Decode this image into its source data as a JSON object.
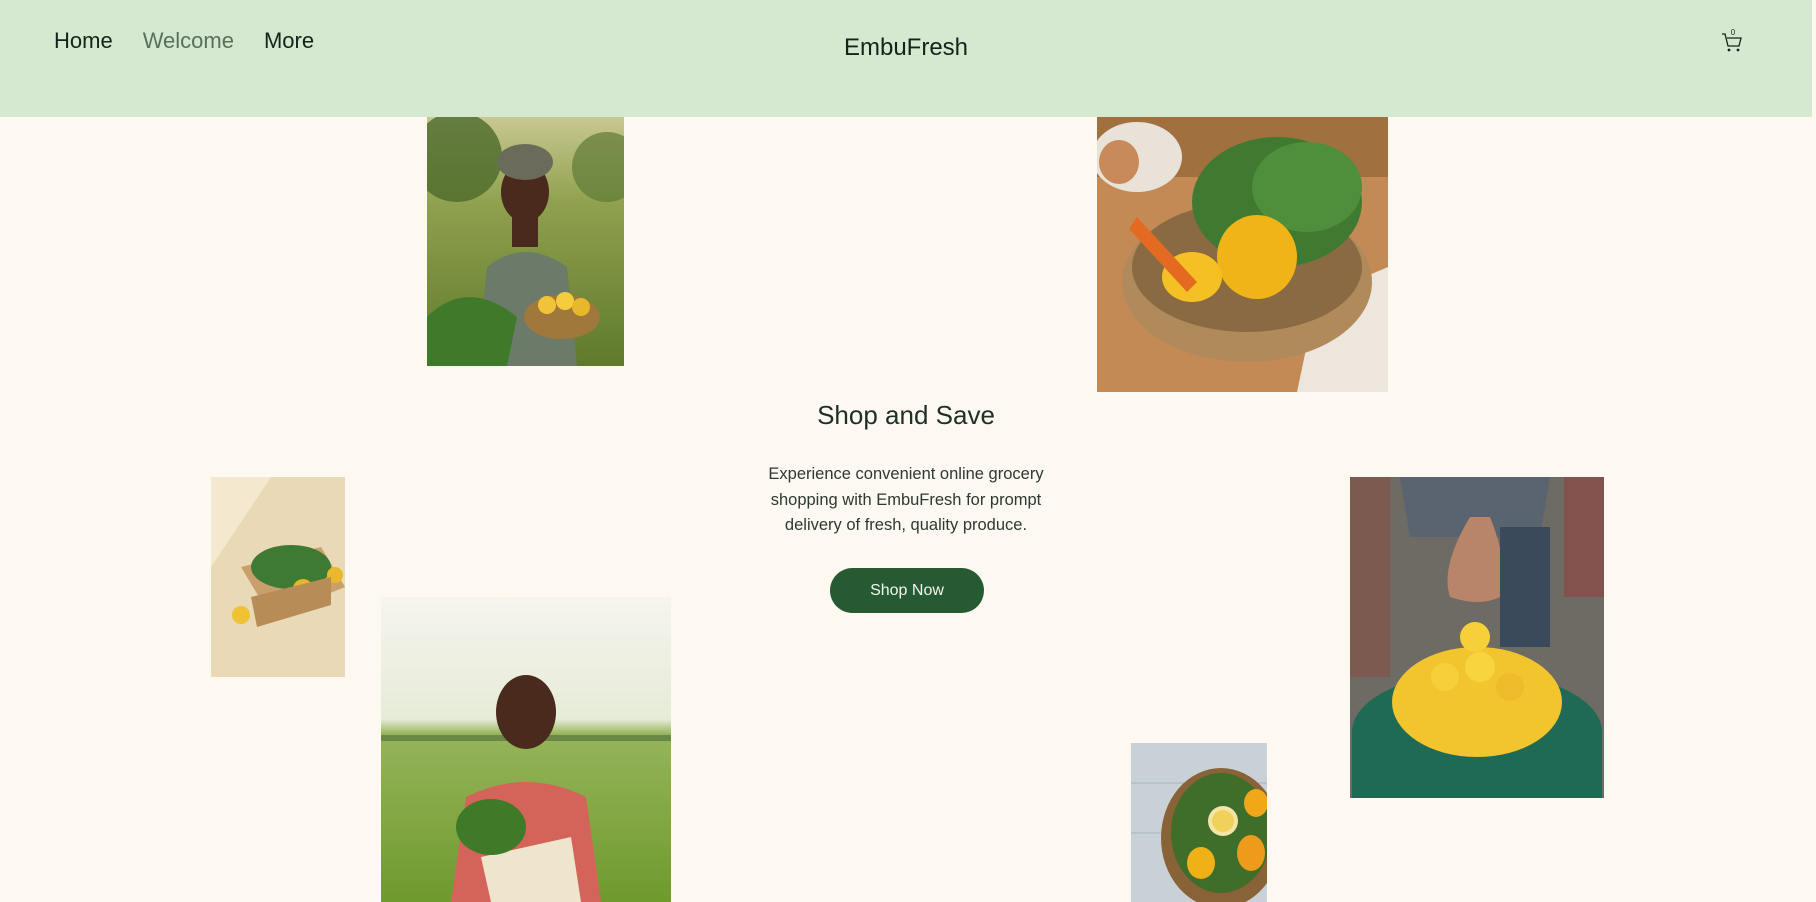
{
  "header": {
    "nav": [
      {
        "label": "Home"
      },
      {
        "label": "Welcome"
      },
      {
        "label": "More"
      }
    ],
    "brand": "EmbuFresh",
    "cart_count": "0",
    "cart_icon": "shopping-cart-icon"
  },
  "hero": {
    "title": "Shop and Save",
    "text": "Experience convenient online grocery shopping with EmbuFresh for prompt delivery of fresh, quality produce.",
    "cta_label": "Shop Now"
  },
  "colors": {
    "header_bg": "#d4e9d0",
    "page_bg": "#fdf8f0",
    "button_bg": "#265a32",
    "button_text": "#f2f6ee"
  }
}
